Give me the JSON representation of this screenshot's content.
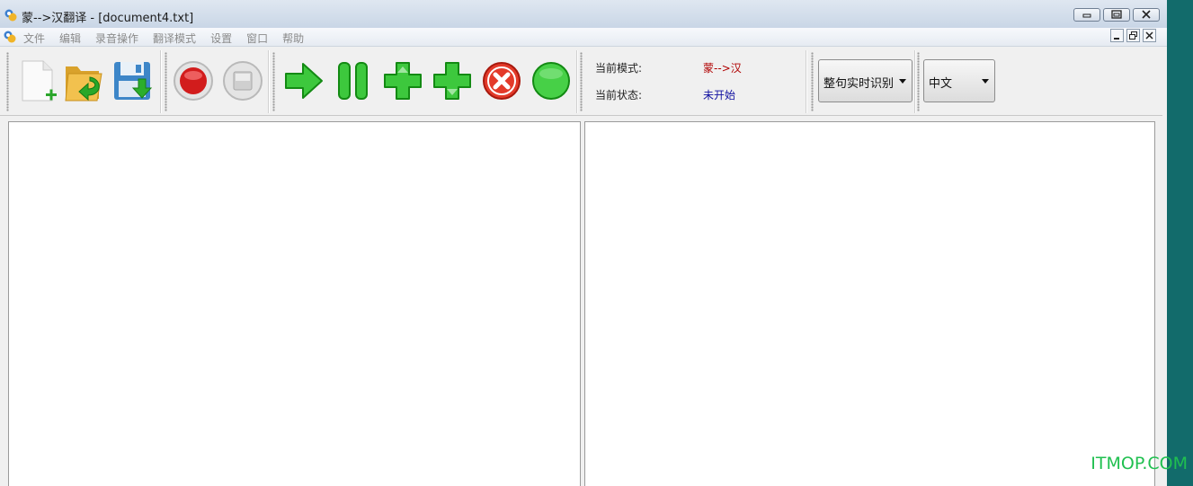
{
  "window": {
    "title": "蒙-->汉翻译 - [document4.txt]"
  },
  "menu": {
    "items": [
      {
        "label": "文件"
      },
      {
        "label": "编辑"
      },
      {
        "label": "录音操作"
      },
      {
        "label": "翻译模式"
      },
      {
        "label": "设置"
      },
      {
        "label": "窗口"
      },
      {
        "label": "帮助"
      }
    ]
  },
  "toolbar": {
    "icons": [
      "new-file-icon",
      "open-file-icon",
      "save-file-icon",
      "record-icon",
      "stop-icon",
      "play-arrow-icon",
      "pause-icon",
      "add-up-icon",
      "add-down-icon",
      "cancel-icon",
      "confirm-circle-icon"
    ]
  },
  "status": {
    "mode_label": "当前模式:",
    "mode_value": "蒙-->汉",
    "state_label": "当前状态:",
    "state_value": "未开始",
    "mode_color": "#b00000",
    "state_color": "#1010a0"
  },
  "dropdowns": {
    "recognition": "整句实时识别",
    "language": "中文"
  },
  "watermark": "ITMOP.COM"
}
